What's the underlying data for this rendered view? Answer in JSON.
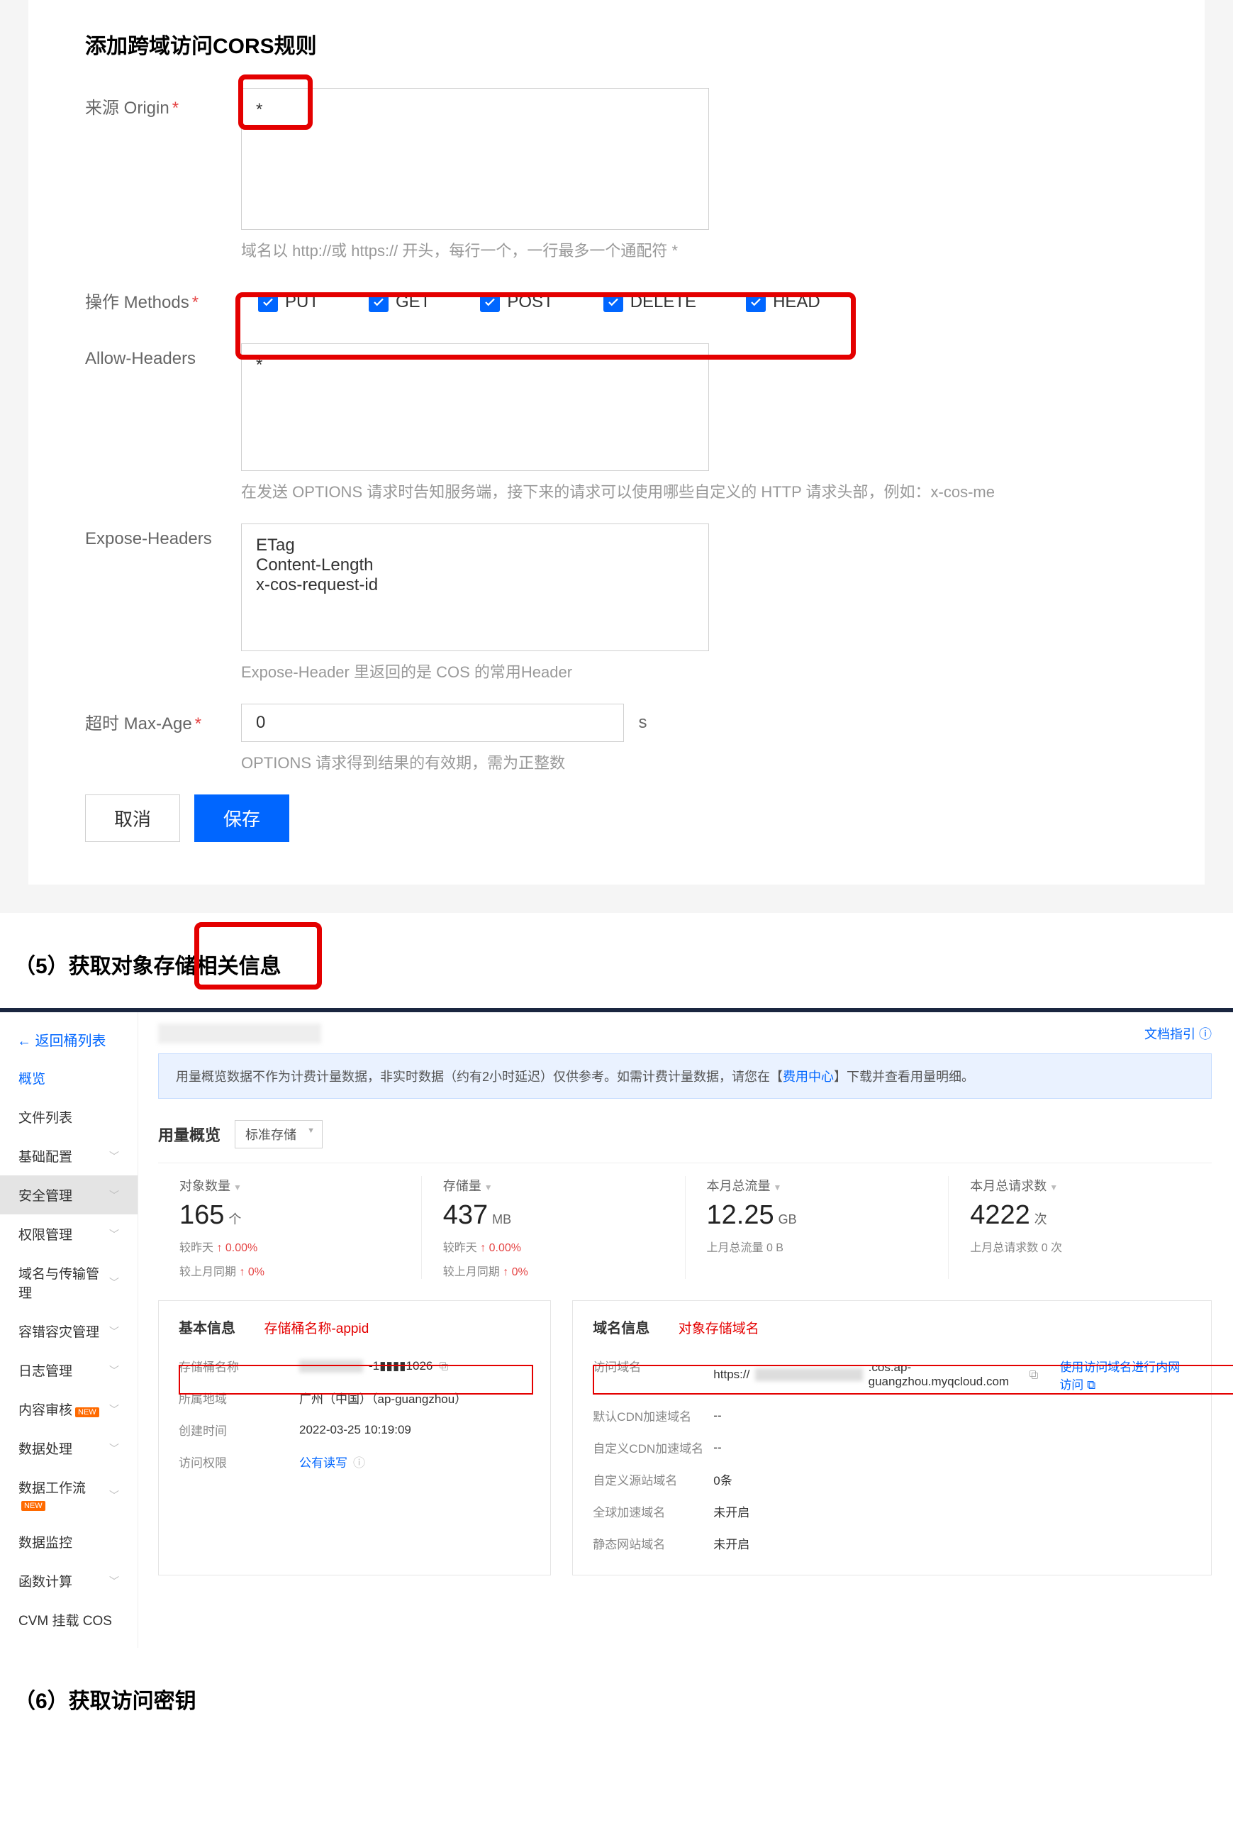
{
  "cors": {
    "title": "添加跨域访问CORS规则",
    "origin_label": "来源 Origin",
    "origin_value": "*",
    "origin_hint": "域名以 http://或 https:// 开头，每行一个，一行最多一个通配符 *",
    "methods_label": "操作 Methods",
    "methods": [
      "PUT",
      "GET",
      "POST",
      "DELETE",
      "HEAD"
    ],
    "allow_headers_label": "Allow-Headers",
    "allow_headers_value": "*",
    "allow_headers_hint": "在发送 OPTIONS 请求时告知服务端，接下来的请求可以使用哪些自定义的 HTTP 请求头部，例如：x-cos-me",
    "expose_headers_label": "Expose-Headers",
    "expose_headers_value": "ETag\nContent-Length\nx-cos-request-id",
    "expose_headers_hint": "Expose-Header 里返回的是 COS 的常用Header",
    "max_age_label": "超时 Max-Age",
    "max_age_value": "0",
    "max_age_unit": "s",
    "max_age_hint": "OPTIONS 请求得到结果的有效期，需为正整数",
    "cancel": "取消",
    "save": "保存"
  },
  "sec5_title": "（5）获取对象存储相关信息",
  "sec6_title": "（6）获取访问密钥",
  "console": {
    "back": "← 返回桶列表",
    "doc_guide": "文档指引",
    "sidebar": [
      {
        "label": "概览",
        "active": "blue"
      },
      {
        "label": "文件列表"
      },
      {
        "label": "基础配置",
        "expand": true
      },
      {
        "label": "安全管理",
        "expand": true,
        "active": "bg"
      },
      {
        "label": "权限管理",
        "expand": true
      },
      {
        "label": "域名与传输管理",
        "expand": true
      },
      {
        "label": "容错容灾管理",
        "expand": true
      },
      {
        "label": "日志管理",
        "expand": true
      },
      {
        "label": "内容审核",
        "badge": "NEW",
        "expand": true
      },
      {
        "label": "数据处理",
        "expand": true
      },
      {
        "label": "数据工作流",
        "badge": "NEW",
        "expand": true
      },
      {
        "label": "数据监控"
      },
      {
        "label": "函数计算",
        "expand": true
      },
      {
        "label": "CVM 挂载 COS"
      }
    ],
    "banner": {
      "pre": "用量概览数据不作为计费计量数据，非实时数据（约有2小时延迟）仅供参考。如需计费计量数据，请您在【",
      "link": "费用中心",
      "post": "】下载并查看用量明细。"
    },
    "usage_title": "用量概览",
    "storage_type": "标准存储",
    "stats": [
      {
        "label": "对象数量",
        "value": "165",
        "unit": "个",
        "sub1": "较昨天 ↑ 0.00%",
        "sub2": "较上月同期 ↑ 0%"
      },
      {
        "label": "存储量",
        "value": "437",
        "unit": "MB",
        "sub1": "较昨天 ↑ 0.00%",
        "sub2": "较上月同期 ↑ 0%"
      },
      {
        "label": "本月总流量",
        "value": "12.25",
        "unit": "GB",
        "sub1": "上月总流量 0 B",
        "sub2": ""
      },
      {
        "label": "本月总请求数",
        "value": "4222",
        "unit": "次",
        "sub1": "上月总请求数 0 次",
        "sub2": ""
      }
    ],
    "basic_info": {
      "title": "基本信息",
      "red_label": "存储桶名称-appid",
      "rows": [
        {
          "k": "存储桶名称",
          "v_suffix": "-1▮▮▮▮1026",
          "copy": true
        },
        {
          "k": "所属地域",
          "v": "广州（中国）（ap-guangzhou）"
        },
        {
          "k": "创建时间",
          "v": "2022-03-25 10:19:09"
        },
        {
          "k": "访问权限",
          "v": "公有读写",
          "link": true,
          "info": true
        }
      ]
    },
    "domain_info": {
      "title": "域名信息",
      "red_label": "对象存储域名",
      "ext_link": "使用访问域名进行内网访问",
      "rows": [
        {
          "k": "访问域名",
          "v_prefix": "https://",
          "v_suffix": ".cos.ap-guangzhou.myqcloud.com",
          "copy": true
        },
        {
          "k": "默认CDN加速域名",
          "v": "--"
        },
        {
          "k": "自定义CDN加速域名",
          "v": "--"
        },
        {
          "k": "自定义源站域名",
          "v": "0条"
        },
        {
          "k": "全球加速域名",
          "v": "未开启"
        },
        {
          "k": "静态网站域名",
          "v": "未开启"
        }
      ]
    }
  }
}
